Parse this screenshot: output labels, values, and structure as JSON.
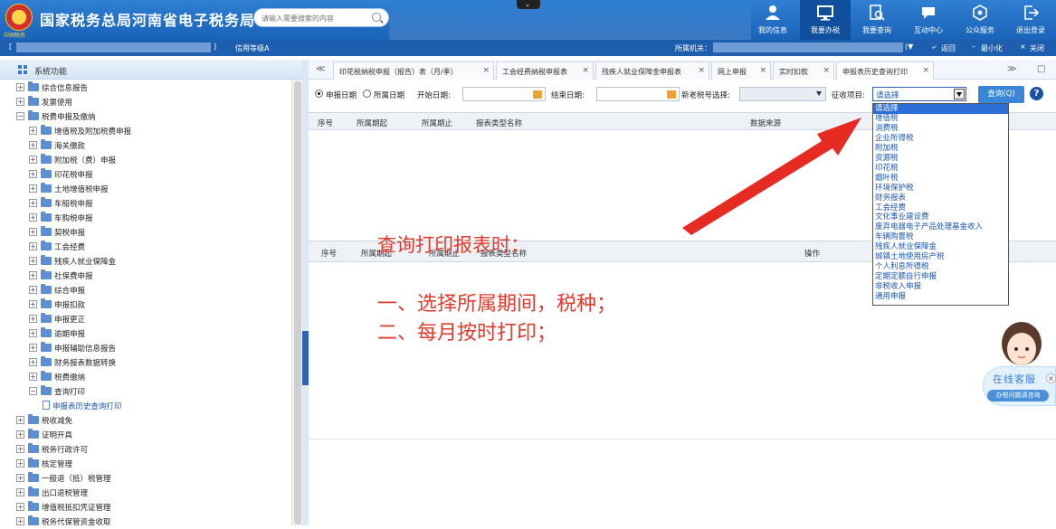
{
  "header": {
    "title": "国家税务总局河南省电子税务局",
    "emblem_text": "中国税务",
    "search_placeholder": "请输入需要搜索的内容",
    "nav": [
      {
        "label": "我的信息",
        "icon": "user-icon"
      },
      {
        "label": "我要办税",
        "icon": "monitor-icon"
      },
      {
        "label": "我要查询",
        "icon": "search-doc-icon"
      },
      {
        "label": "互动中心",
        "icon": "chat-icon"
      },
      {
        "label": "公众服务",
        "icon": "service-icon"
      },
      {
        "label": "退出登录",
        "icon": "logout-icon"
      }
    ]
  },
  "subbar": {
    "open_bracket": "[",
    "close_bracket": "]",
    "credit_label": "信用等级A",
    "org_label": "所属机关：",
    "dropdown_glyph": "(▼",
    "back": "返回",
    "minimize": "最小化",
    "close": "关闭"
  },
  "sidebar": {
    "title": "系统功能",
    "items": [
      {
        "label": "综合信息报告",
        "depth": 0,
        "expanded": false
      },
      {
        "label": "发票使用",
        "depth": 0,
        "expanded": false
      },
      {
        "label": "税费申报及缴纳",
        "depth": 0,
        "expanded": true
      },
      {
        "label": "增值税及附加税费申报",
        "depth": 1,
        "expanded": false
      },
      {
        "label": "海关缴款",
        "depth": 1,
        "expanded": false
      },
      {
        "label": "附加税（费）申报",
        "depth": 1,
        "expanded": false
      },
      {
        "label": "印花税申报",
        "depth": 1,
        "expanded": false
      },
      {
        "label": "土地增值税申报",
        "depth": 1,
        "expanded": false
      },
      {
        "label": "车船税申报",
        "depth": 1,
        "expanded": false
      },
      {
        "label": "车购税申报",
        "depth": 1,
        "expanded": false
      },
      {
        "label": "契税申报",
        "depth": 1,
        "expanded": false
      },
      {
        "label": "工会经费",
        "depth": 1,
        "expanded": false
      },
      {
        "label": "残疾人就业保障金",
        "depth": 1,
        "expanded": false
      },
      {
        "label": "社保费申报",
        "depth": 1,
        "expanded": false
      },
      {
        "label": "综合申报",
        "depth": 1,
        "expanded": false
      },
      {
        "label": "申报扣款",
        "depth": 1,
        "expanded": false
      },
      {
        "label": "申报更正",
        "depth": 1,
        "expanded": false
      },
      {
        "label": "逾期申报",
        "depth": 1,
        "expanded": false
      },
      {
        "label": "申报辅助信息报告",
        "depth": 1,
        "expanded": false
      },
      {
        "label": "财务报表数据转换",
        "depth": 1,
        "expanded": false
      },
      {
        "label": "税费缴纳",
        "depth": 1,
        "expanded": false
      },
      {
        "label": "查询打印",
        "depth": 1,
        "expanded": true
      },
      {
        "label": "申报表历史查询打印",
        "depth": 2,
        "leaf": true
      },
      {
        "label": "税收减免",
        "depth": 0,
        "expanded": false
      },
      {
        "label": "证明开具",
        "depth": 0,
        "expanded": false
      },
      {
        "label": "税务行政许可",
        "depth": 0,
        "expanded": false
      },
      {
        "label": "核定管理",
        "depth": 0,
        "expanded": false
      },
      {
        "label": "一般退（抵）税管理",
        "depth": 0,
        "expanded": false
      },
      {
        "label": "出口退税管理",
        "depth": 0,
        "expanded": false
      },
      {
        "label": "增值税抵扣凭证管理",
        "depth": 0,
        "expanded": false
      },
      {
        "label": "税务代保管资金收取",
        "depth": 0,
        "expanded": false
      }
    ]
  },
  "tabs": {
    "prev": "≪",
    "next": "≫",
    "restore": "□",
    "items": [
      {
        "label": "印花税纳税申报（报告）表（月/季）",
        "closable": true
      },
      {
        "label": "工会经费纳税申报表",
        "closable": true
      },
      {
        "label": "残疾人就业保障金申报表",
        "closable": true
      },
      {
        "label": "网上申报",
        "closable": true
      },
      {
        "label": "实时扣款",
        "closable": true
      },
      {
        "label": "申报表历史查询打印",
        "closable": true,
        "active": true
      }
    ]
  },
  "filter": {
    "radio_report_date": "申报日期",
    "radio_period_date": "所属日期",
    "start_date_label": "开始日期:",
    "end_date_label": "结束日期:",
    "new_tax_id_label": "新老税号选择:",
    "tax_item_label": "征收项目:",
    "tax_item_value": "请选择",
    "query_button": "查询(Q)",
    "help": "?"
  },
  "grid1": {
    "columns": [
      "序号",
      "所属期起",
      "所属期止",
      "报表类型名称",
      "数据来源"
    ]
  },
  "grid2": {
    "columns": [
      "序号",
      "所属期起",
      "所属期止",
      "报表类型名称",
      "操作"
    ]
  },
  "tax_options": [
    "请选择",
    "增值税",
    "消费税",
    "企业所得税",
    "附加税",
    "资源税",
    "印花税",
    "烟叶税",
    "环境保护税",
    "财务报表",
    "工会经费",
    "文化事业建设费",
    "废弃电器电子产品处理基金收入",
    "车辆购置税",
    "残疾人就业保障金",
    "城镇土地使用房产税",
    "个人利息所得税",
    "定期定额自行申报",
    "非税收入申报",
    "通用申报"
  ],
  "annotation": {
    "title": "查询打印报表时：",
    "line1": "一、选择所属期间，税种；",
    "line2": "二、每月按时打印；"
  },
  "kefu": {
    "title": "在线客服",
    "subtitle": "办税问题请咨询",
    "close": "×"
  },
  "colors": {
    "header_blue": "#1a63b8",
    "annotation_red": "#e23b2e",
    "selected_option": "#2d6fd6"
  }
}
